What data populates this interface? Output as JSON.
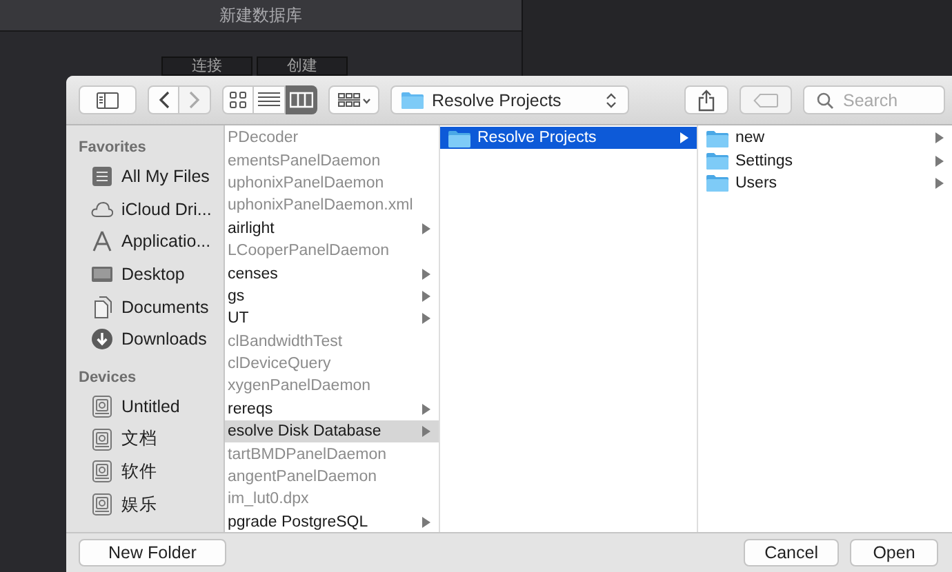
{
  "background_window": {
    "title": "新建数据库",
    "tabs": [
      {
        "label": "连接"
      },
      {
        "label": "创建"
      }
    ]
  },
  "toolbar": {
    "view_modes": [
      {
        "kind": "icons",
        "selected": false
      },
      {
        "kind": "list",
        "selected": false
      },
      {
        "kind": "columns",
        "selected": true
      }
    ],
    "location": "Resolve Projects",
    "tag_button": {
      "disabled": true
    },
    "search": {
      "placeholder": "Search"
    }
  },
  "sidebar": {
    "sections": [
      {
        "heading": "Favorites",
        "items": [
          {
            "label": "All My Files",
            "kind": "all-files"
          },
          {
            "label": "iCloud Dri...",
            "kind": "cloud"
          },
          {
            "label": "Applicatio...",
            "kind": "apps"
          },
          {
            "label": "Desktop",
            "kind": "desktop"
          },
          {
            "label": "Documents",
            "kind": "documents"
          },
          {
            "label": "Downloads",
            "kind": "downloads"
          }
        ]
      },
      {
        "heading": "Devices",
        "items": [
          {
            "label": "Untitled",
            "kind": "disk"
          },
          {
            "label": "文档",
            "kind": "disk"
          },
          {
            "label": "软件",
            "kind": "disk"
          },
          {
            "label": "娱乐",
            "kind": "disk"
          }
        ]
      }
    ]
  },
  "columns": [
    {
      "icons": false,
      "focused": false,
      "items": [
        {
          "name": "PDecoder",
          "kind": "file",
          "selected": false
        },
        {
          "name": "ementsPanelDaemon",
          "kind": "file",
          "selected": false
        },
        {
          "name": "uphonixPanelDaemon",
          "kind": "file",
          "selected": false
        },
        {
          "name": "uphonixPanelDaemon.xml",
          "kind": "file",
          "selected": false
        },
        {
          "name": "airlight",
          "kind": "folder",
          "selected": false
        },
        {
          "name": "LCooperPanelDaemon",
          "kind": "file",
          "selected": false
        },
        {
          "name": "censes",
          "kind": "folder",
          "selected": false
        },
        {
          "name": "gs",
          "kind": "folder",
          "selected": false
        },
        {
          "name": "UT",
          "kind": "folder",
          "selected": false
        },
        {
          "name": "clBandwidthTest",
          "kind": "file",
          "selected": false
        },
        {
          "name": "clDeviceQuery",
          "kind": "file",
          "selected": false
        },
        {
          "name": "xygenPanelDaemon",
          "kind": "file",
          "selected": false
        },
        {
          "name": "rereqs",
          "kind": "folder",
          "selected": false
        },
        {
          "name": "esolve Disk Database",
          "kind": "folder",
          "selected": true
        },
        {
          "name": "tartBMDPanelDaemon",
          "kind": "file",
          "selected": false
        },
        {
          "name": "angentPanelDaemon",
          "kind": "file",
          "selected": false
        },
        {
          "name": "im_lut0.dpx",
          "kind": "file",
          "selected": false
        },
        {
          "name": "pgrade PostgreSQL",
          "kind": "folder",
          "selected": false
        }
      ]
    },
    {
      "icons": true,
      "focused": true,
      "items": [
        {
          "name": "Resolve Projects",
          "kind": "folder",
          "selected": true
        }
      ]
    },
    {
      "icons": true,
      "items": [
        {
          "name": "new",
          "kind": "folder",
          "selected": false
        },
        {
          "name": "Settings",
          "kind": "folder",
          "selected": false
        },
        {
          "name": "Users",
          "kind": "folder",
          "selected": false
        }
      ]
    }
  ],
  "buttons_left": [
    {
      "label": "New Folder"
    }
  ],
  "buttons_right": [
    {
      "label": "Cancel"
    },
    {
      "label": "Open"
    }
  ]
}
